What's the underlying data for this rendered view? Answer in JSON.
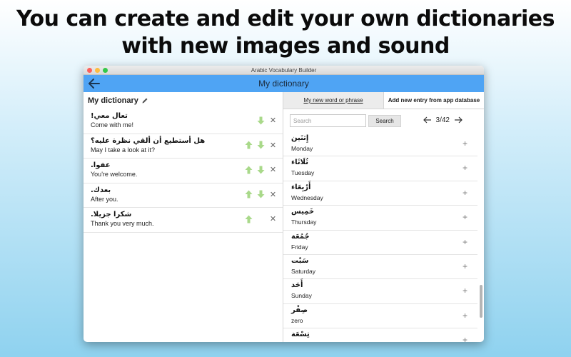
{
  "promo": {
    "line1": "You can create and edit your own dictionaries",
    "line2": "with new images and sound"
  },
  "window": {
    "title": "Arabic Vocabulary Builder"
  },
  "navbar": {
    "title": "My dictionary",
    "back_icon": "back-arrow-icon"
  },
  "left_panel": {
    "title": "My dictionary",
    "edit_icon": "pencil-icon",
    "entries": [
      {
        "arabic": "تعال معي!",
        "english": "Come with me!",
        "up": false,
        "down": true
      },
      {
        "arabic": "هل أستطيع أن ألقي نظرة عليه؟",
        "english": "May I take a look at it?",
        "up": true,
        "down": true
      },
      {
        "arabic": "عفوا.",
        "english": "You're welcome.",
        "up": true,
        "down": true
      },
      {
        "arabic": "بعدك.",
        "english": "After you.",
        "up": true,
        "down": true
      },
      {
        "arabic": "شكرا جزيلا.",
        "english": "Thank you very much.",
        "up": true,
        "down": false
      }
    ]
  },
  "tabs": [
    {
      "label": "My new word or phrase",
      "active": false
    },
    {
      "label": "Add new entry from app database",
      "active": true
    }
  ],
  "search": {
    "placeholder": "Search",
    "button_label": "Search"
  },
  "pager": {
    "label": "3/42"
  },
  "words": [
    {
      "arabic": "إِثنَين",
      "english": "Monday"
    },
    {
      "arabic": "ثُلَاثَاء",
      "english": "Tuesday"
    },
    {
      "arabic": "أَرْبِعَاء",
      "english": "Wednesday"
    },
    {
      "arabic": "خَمِيس",
      "english": "Thursday"
    },
    {
      "arabic": "جُمُعَة",
      "english": "Friday"
    },
    {
      "arabic": "سَبْت",
      "english": "Saturday"
    },
    {
      "arabic": "أَحَد",
      "english": "Sunday"
    },
    {
      "arabic": "صِفْر",
      "english": "zero"
    },
    {
      "arabic": "تِسْعَة",
      "english": ""
    }
  ],
  "colors": {
    "navbar": "#4fa4f4",
    "arrow_green": "#a9d98a"
  }
}
